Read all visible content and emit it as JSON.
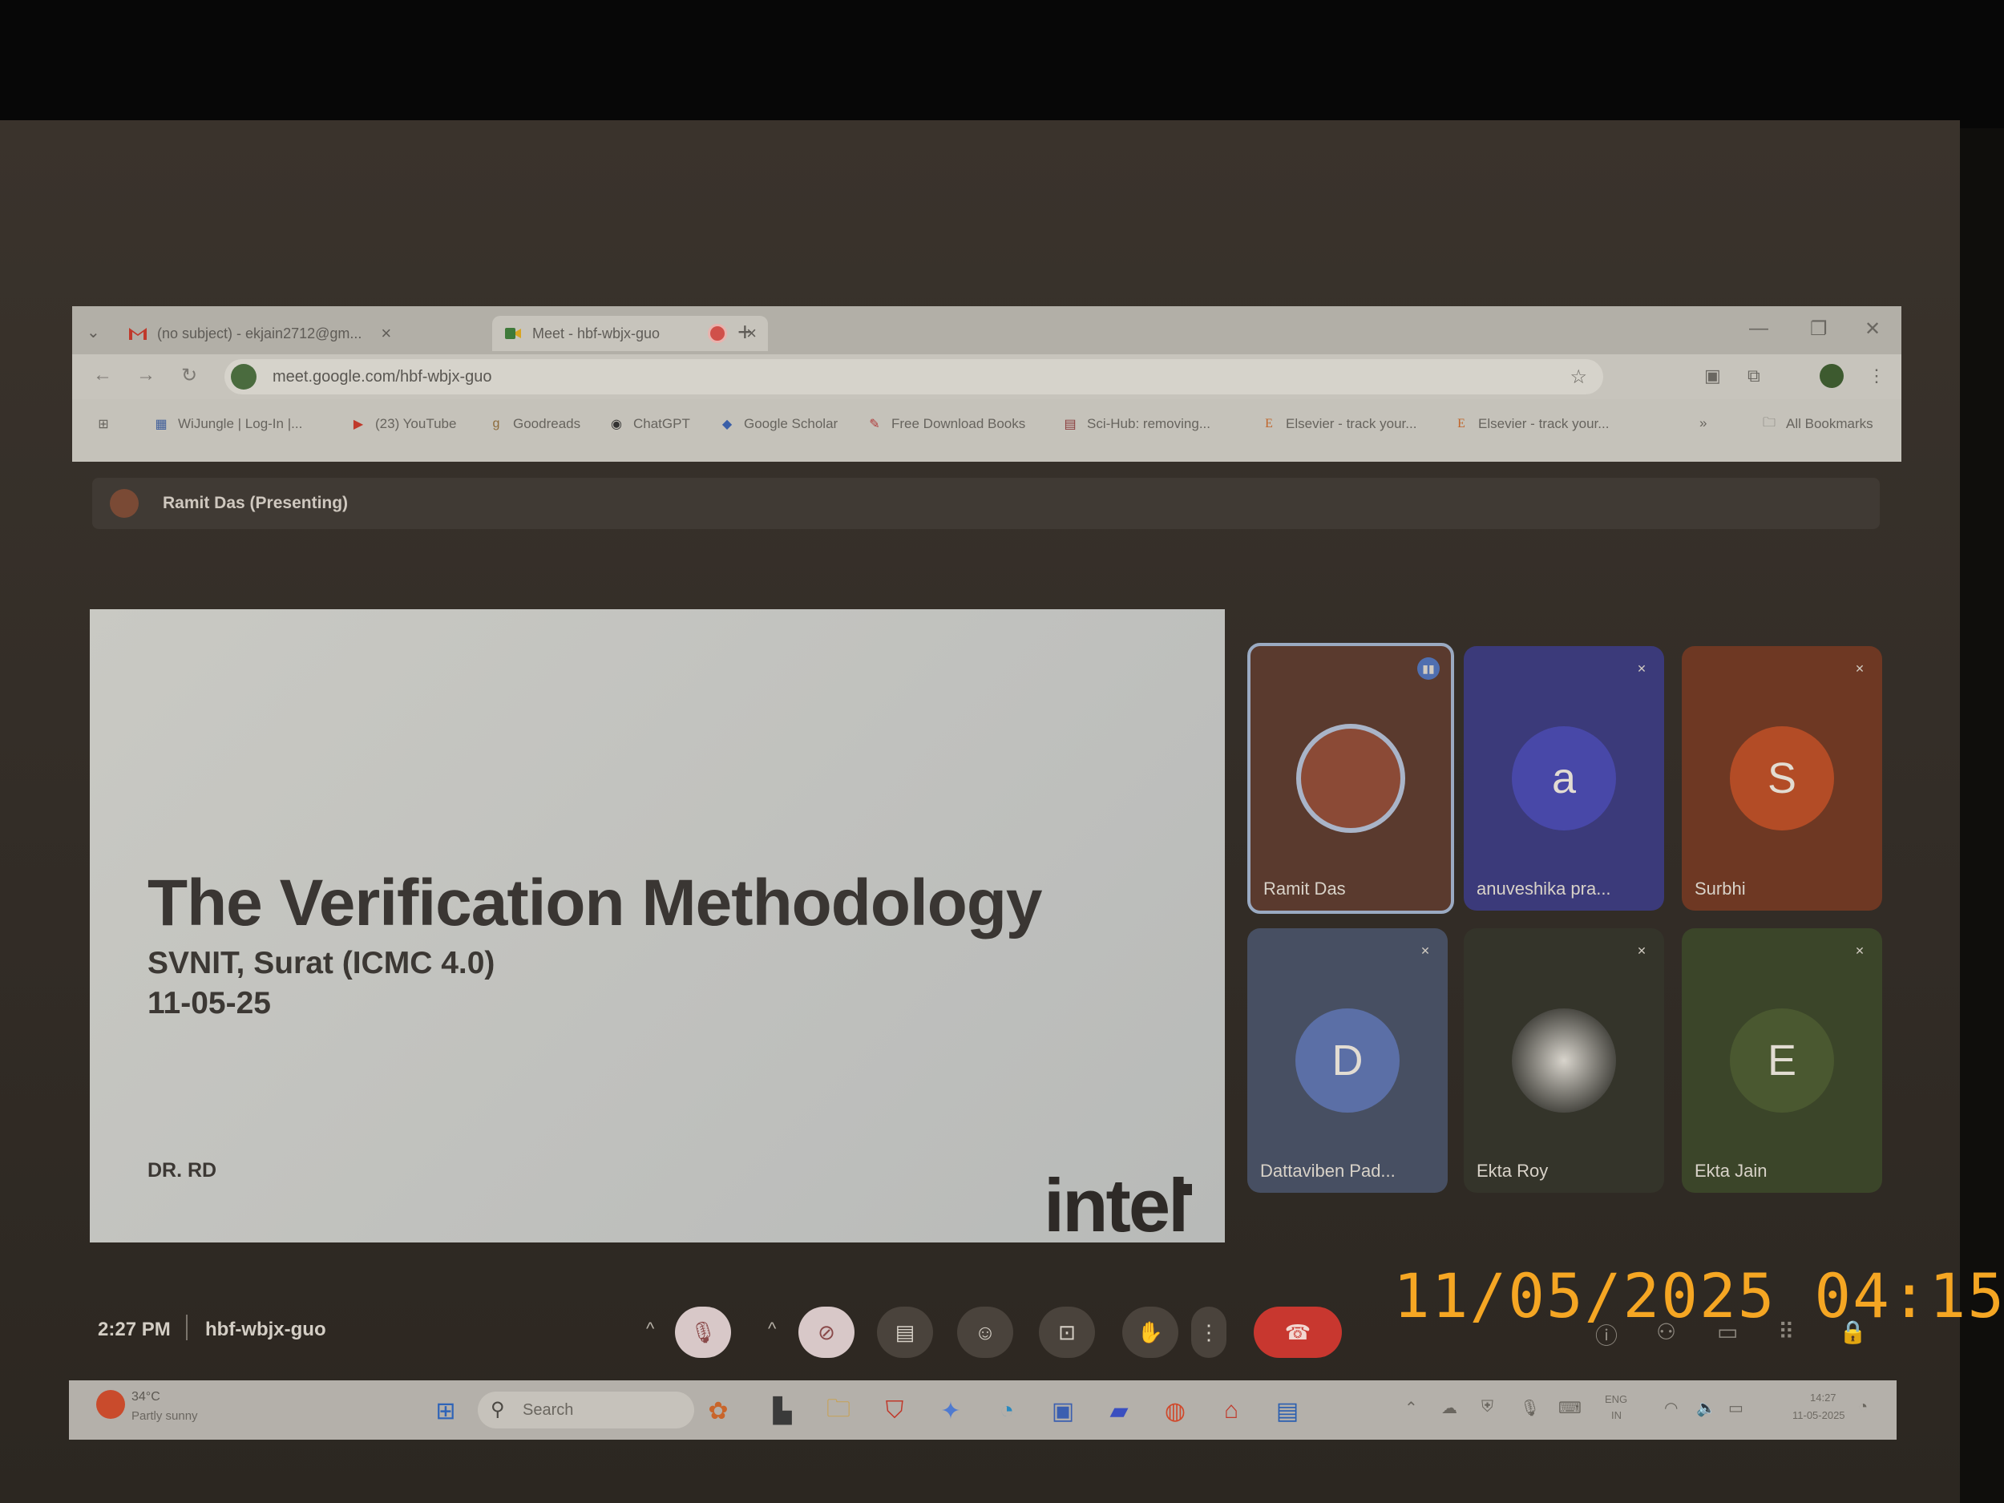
{
  "browser": {
    "tabs": [
      {
        "label": "(no subject) - ekjain2712@gm...",
        "icon": "gmail-icon"
      },
      {
        "label": "Meet - hbf-wbjx-guo",
        "icon": "meet-icon",
        "recording": true
      }
    ],
    "url": "meet.google.com/hbf-wbjx-guo",
    "bookmarks": [
      {
        "label": "WiJungle | Log-In |...",
        "icon": "wijungle-icon"
      },
      {
        "label": "(23) YouTube",
        "icon": "youtube-icon"
      },
      {
        "label": "Goodreads",
        "icon": "goodreads-icon"
      },
      {
        "label": "ChatGPT",
        "icon": "chatgpt-icon"
      },
      {
        "label": "Google Scholar",
        "icon": "scholar-icon"
      },
      {
        "label": "Free Download Books",
        "icon": "books-icon"
      },
      {
        "label": "Sci-Hub: removing...",
        "icon": "scihub-icon"
      },
      {
        "label": "Elsevier - track your...",
        "icon": "elsevier-icon"
      },
      {
        "label": "Elsevier - track your...",
        "icon": "elsevier-icon"
      }
    ],
    "all_bookmarks": "All Bookmarks"
  },
  "meet": {
    "presenting": "Ramit Das (Presenting)",
    "slide": {
      "title": "The Verification Methodology",
      "subtitle": "SVNIT, Surat (ICMC 4.0)",
      "date": "11-05-25",
      "author": "DR. RD",
      "logo": "intel"
    },
    "participants": [
      {
        "name": "Ramit Das",
        "initial": "",
        "color": "#5a3a2e"
      },
      {
        "name": "anuveshika pra...",
        "initial": "a",
        "color": "#3b3a7a"
      },
      {
        "name": "Surbhi",
        "initial": "S",
        "color": "#7a3b23"
      },
      {
        "name": "Dattaviben Pad...",
        "initial": "D",
        "color": "#4a5a7e"
      },
      {
        "name": "Ekta Roy",
        "initial": "",
        "color": "#3a3a30"
      },
      {
        "name": "Ekta Jain",
        "initial": "E",
        "color": "#3e4a2a"
      }
    ],
    "time": "2:27 PM",
    "code": "hbf-wbjx-guo",
    "controls": [
      "mic-off-icon",
      "camera-off-icon",
      "captions-icon",
      "emoji-icon",
      "present-icon",
      "raise-hand-icon",
      "more-icon",
      "end-call-icon"
    ],
    "leave_color": "#c8372f"
  },
  "camera_stamp": "11/05/2025  04:15",
  "taskbar": {
    "weather_temp": "34°C",
    "weather_desc": "Partly sunny",
    "search_placeholder": "Search",
    "lang_top": "ENG",
    "lang_bottom": "IN",
    "clock_time": "14:27",
    "clock_date": "11-05-2025"
  }
}
